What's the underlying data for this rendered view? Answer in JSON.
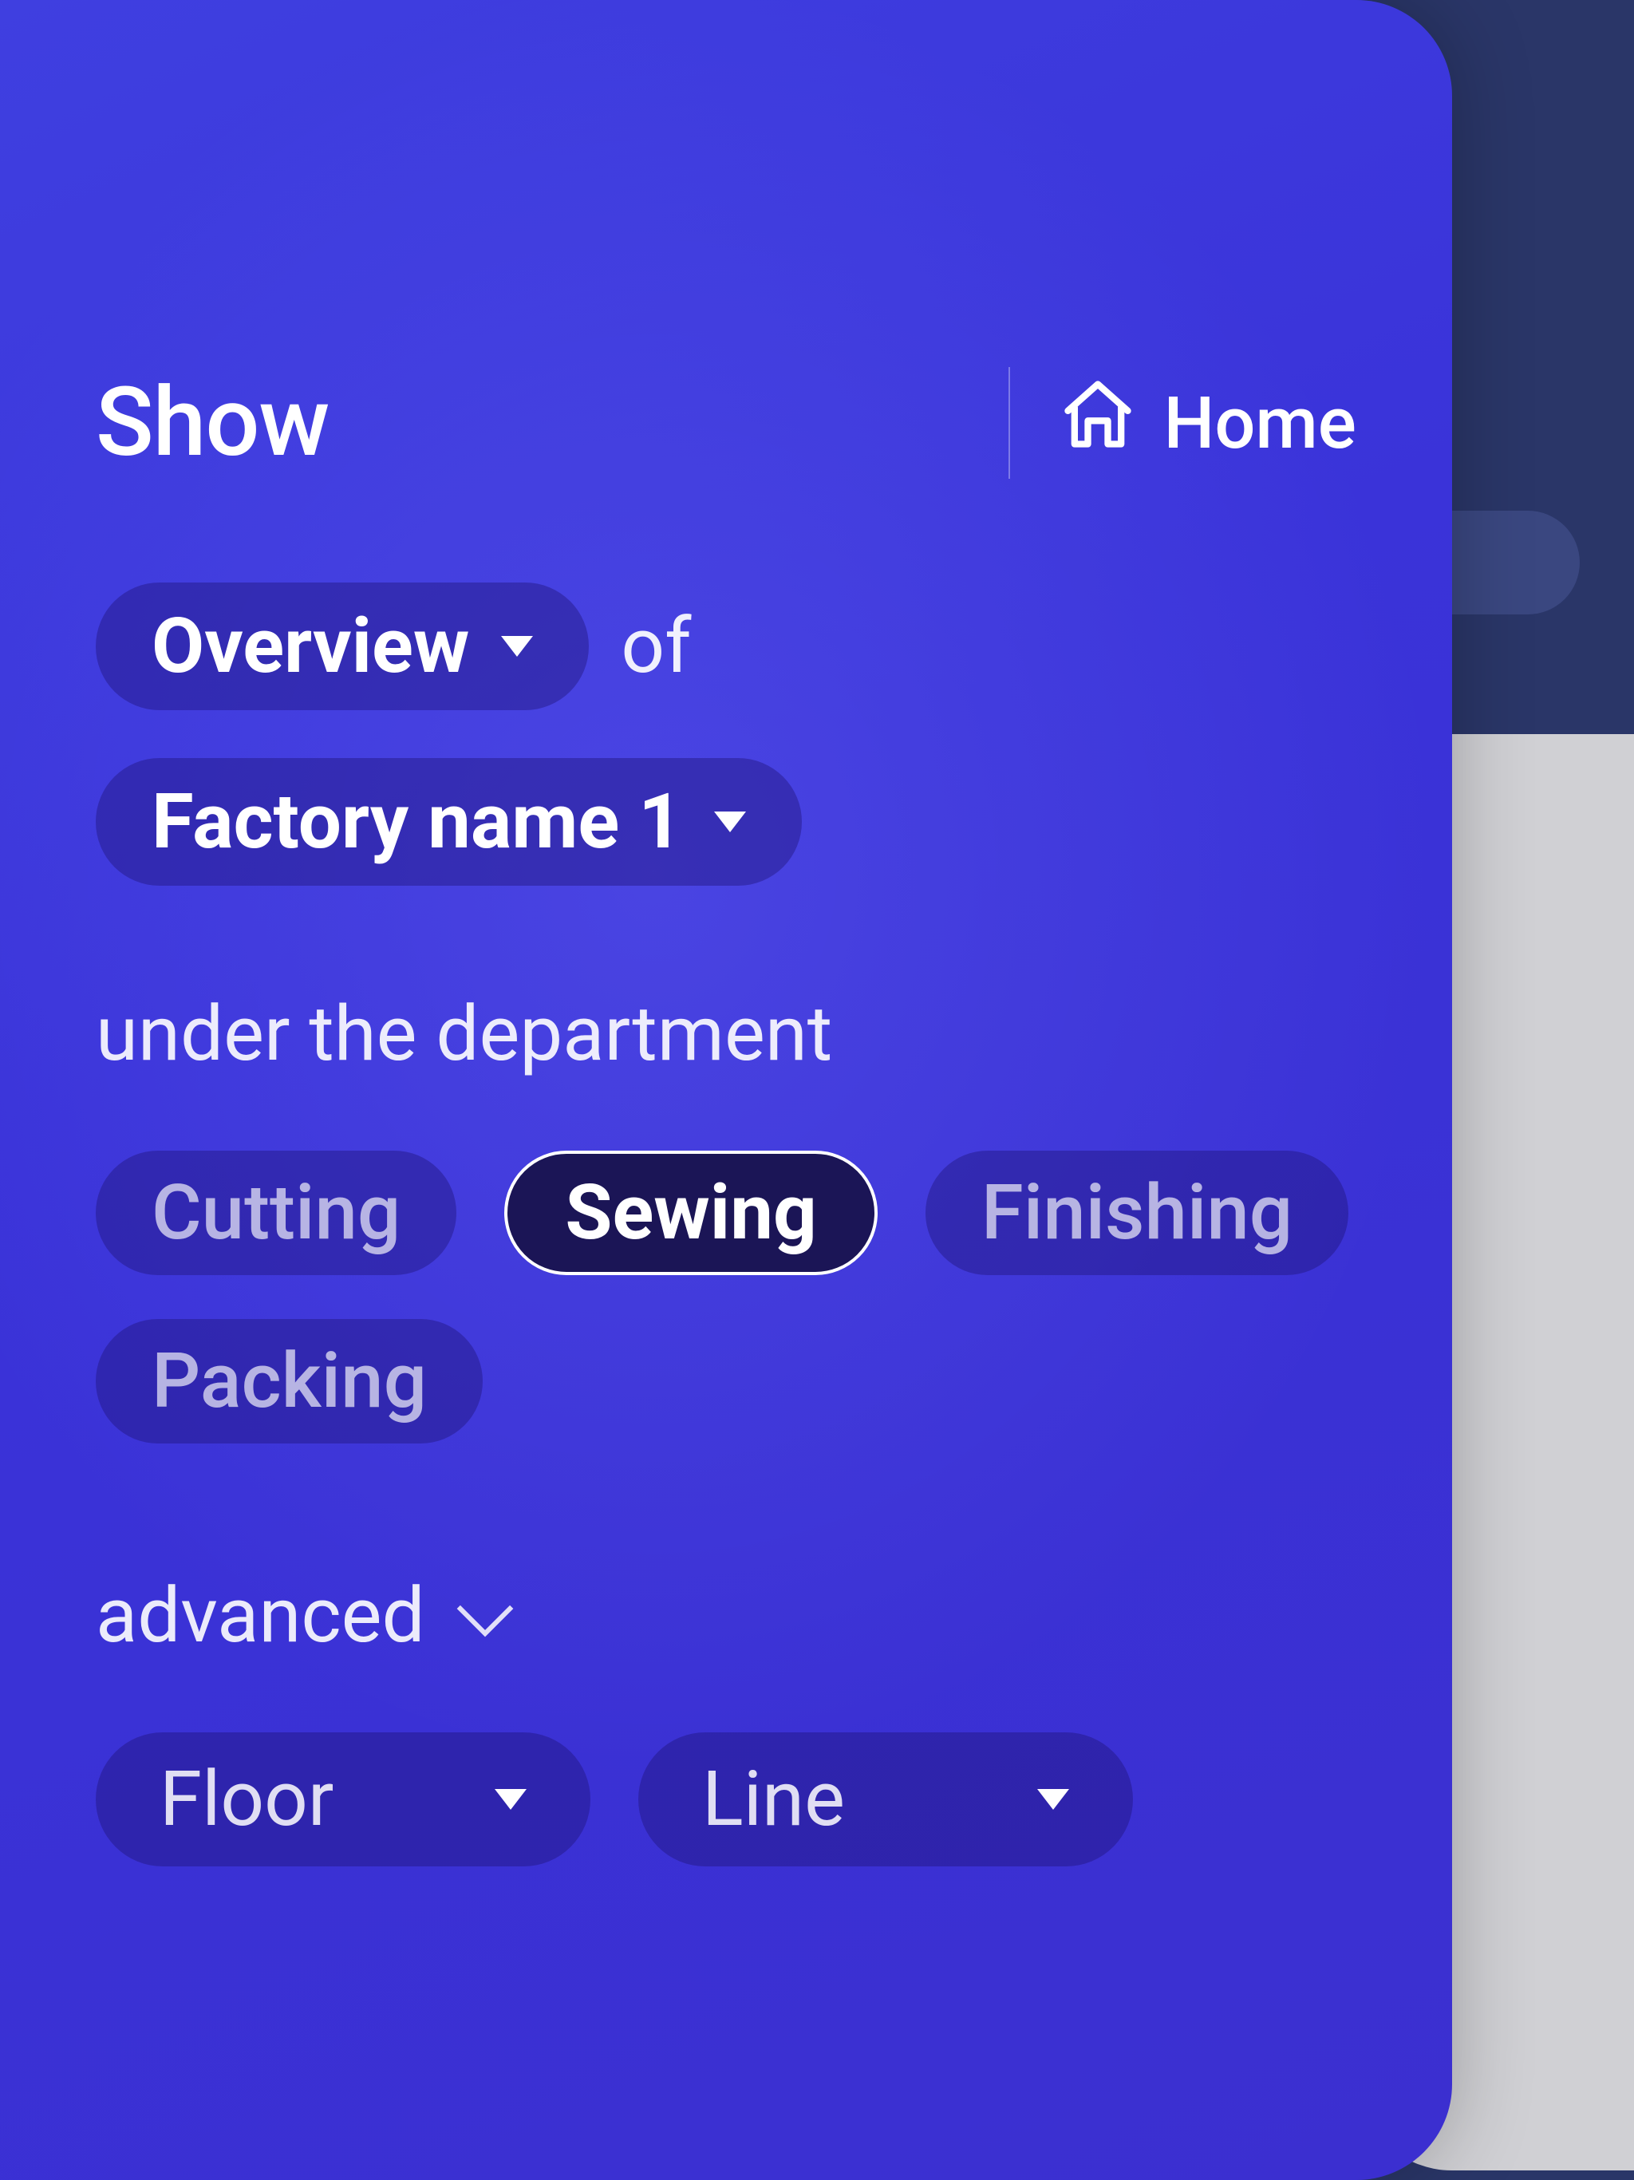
{
  "header": {
    "title": "Show",
    "home_label": "Home"
  },
  "flow": {
    "view_select": "Overview",
    "of_word": "of",
    "factory_select": "Factory name 1"
  },
  "dept": {
    "label": "under the department",
    "options": [
      "Cutting",
      "Sewing",
      "Finishing",
      "Packing"
    ],
    "selected": "Sewing"
  },
  "advanced": {
    "label": "advanced",
    "floor_select": "Floor",
    "line_select": "Line"
  }
}
